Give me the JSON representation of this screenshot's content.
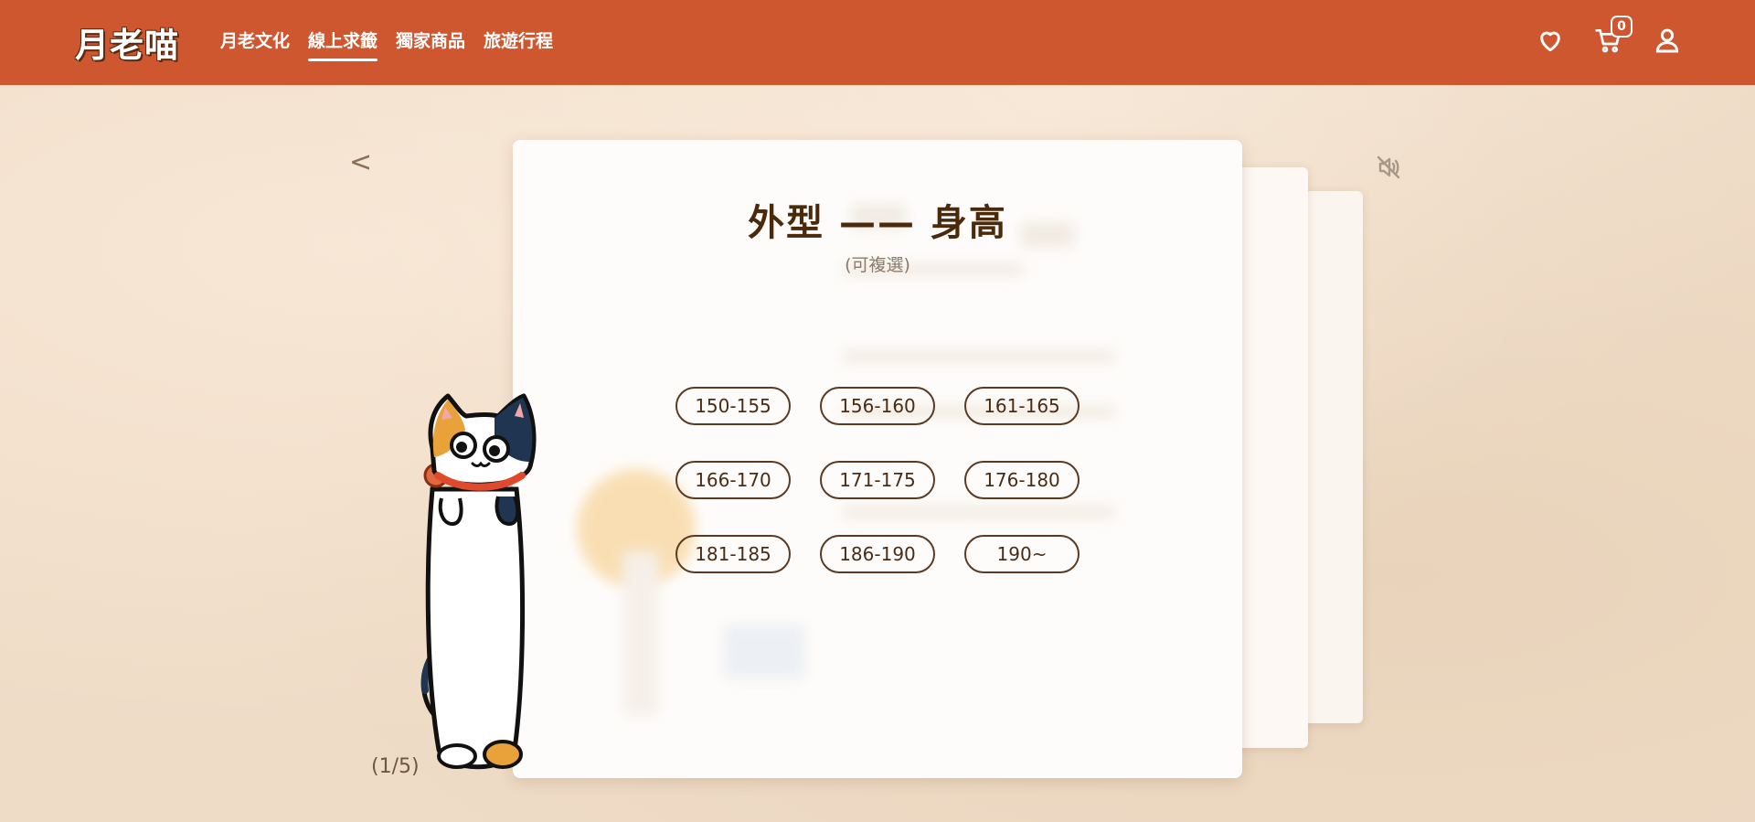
{
  "header": {
    "logo": "月老喵",
    "nav": [
      {
        "label": "月老文化",
        "active": false
      },
      {
        "label": "線上求籤",
        "active": true
      },
      {
        "label": "獨家商品",
        "active": false
      },
      {
        "label": "旅遊行程",
        "active": false
      }
    ],
    "cart_count": "0",
    "icons": [
      "heart-icon",
      "cart-icon",
      "user-icon"
    ]
  },
  "slider": {
    "prev_arrow": "<",
    "page_counter": "(1/5)",
    "mute_icon": "muted-speaker-icon"
  },
  "card": {
    "title": "外型 —— 身高",
    "subtitle": "(可複選)",
    "options": [
      "150-155",
      "156-160",
      "161-165",
      "166-170",
      "171-175",
      "176-180",
      "181-185",
      "186-190",
      "190~"
    ]
  },
  "colors": {
    "header_bg": "#cf5730",
    "page_bg": "#efdcc7",
    "card_bg": "#fefcfa",
    "text_dark": "#4a2c14"
  }
}
